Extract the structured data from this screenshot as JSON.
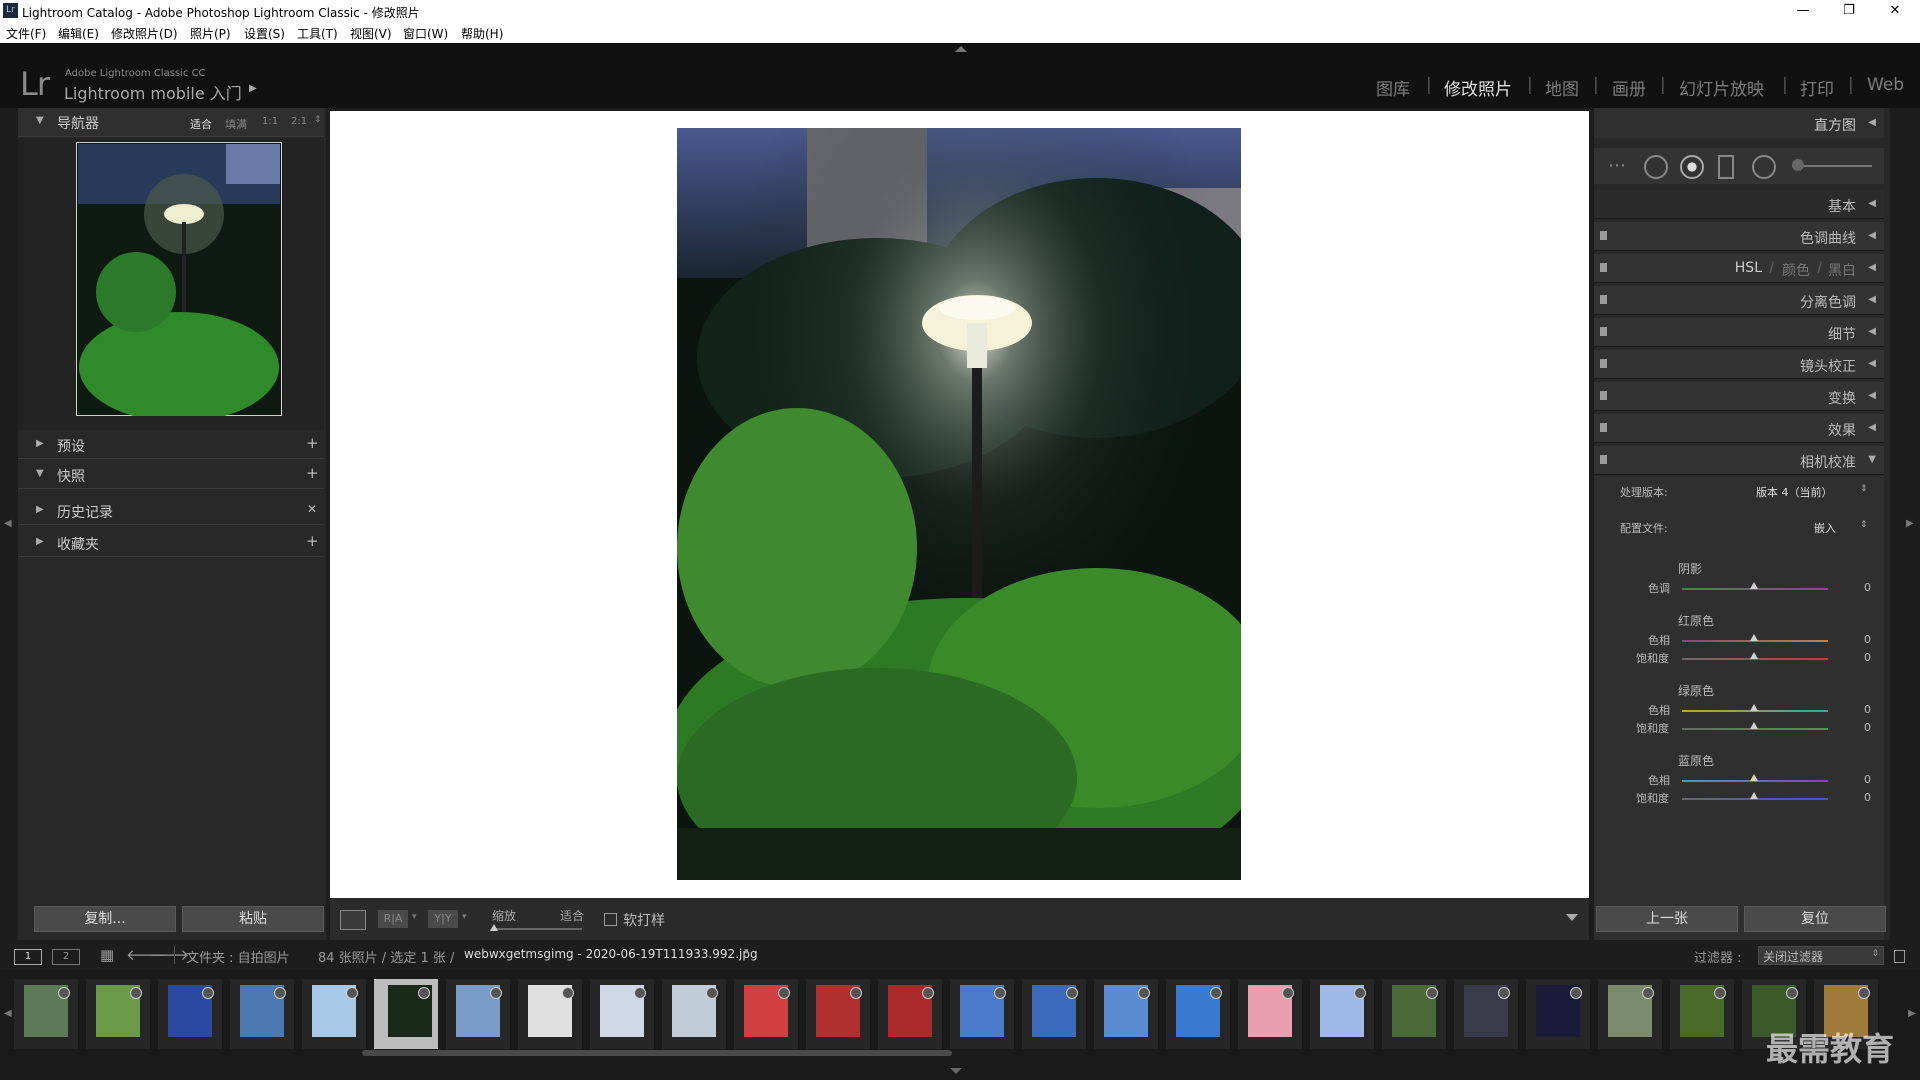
{
  "window": {
    "title": "Lightroom Catalog - Adobe Photoshop Lightroom Classic - 修改照片",
    "app_icon": "Lr",
    "controls": [
      "—",
      "❐",
      "✕"
    ]
  },
  "menu": [
    "文件(F)",
    "编辑(E)",
    "修改照片(D)",
    "照片(P)",
    "设置(S)",
    "工具(T)",
    "视图(V)",
    "窗口(W)",
    "帮助(H)"
  ],
  "header": {
    "logo": "Lr",
    "product_line1": "Adobe Lightroom Classic CC",
    "product_line2": "Lightroom mobile 入门",
    "modules": [
      "图库",
      "修改照片",
      "地图",
      "画册",
      "幻灯片放映",
      "打印",
      "Web"
    ],
    "active_module": "修改照片"
  },
  "left_panel": {
    "navigator": {
      "label": "导航器",
      "zoom_options": [
        "适合",
        "填满",
        "1:1",
        "2:1"
      ],
      "active_zoom": "适合"
    },
    "sections": [
      {
        "label": "预设",
        "action": "+"
      },
      {
        "label": "快照",
        "action": "+"
      },
      {
        "label": "历史记录",
        "action": "✕"
      },
      {
        "label": "收藏夹",
        "action": "+"
      }
    ],
    "copy_button": "复制...",
    "paste_button": "粘贴"
  },
  "toolbar": {
    "zoom_label": "缩放",
    "zoom_value": "适合",
    "soft_proof_label": "软打样",
    "view_buttons": [
      "R|A",
      "Y|Y"
    ]
  },
  "right_panel": {
    "histogram": "直方图",
    "sections": [
      {
        "label": "基本",
        "open": false
      },
      {
        "label": "色调曲线",
        "open": false
      },
      {
        "label": "HSL / 颜色 / 黑白",
        "open": false
      },
      {
        "label": "分离色调",
        "open": false
      },
      {
        "label": "细节",
        "open": false
      },
      {
        "label": "镜头校正",
        "open": false
      },
      {
        "label": "变换",
        "open": false
      },
      {
        "label": "效果",
        "open": false
      },
      {
        "label": "相机校准",
        "open": true
      }
    ],
    "hsl_parts": [
      "HSL",
      "颜色",
      "黑白"
    ],
    "calibration": {
      "process_label": "处理版本:",
      "process_value": "版本 4（当前）",
      "profile_label": "配置文件:",
      "profile_value": "嵌入",
      "groups": [
        {
          "title": "阴影",
          "rows": [
            {
              "label": "色调",
              "value": "0",
              "colors": [
                "#3a8a3a",
                "#a03aa0"
              ]
            }
          ]
        },
        {
          "title": "红原色",
          "rows": [
            {
              "label": "色相",
              "value": "0",
              "colors": [
                "#a03a7a",
                "#c8803a"
              ]
            },
            {
              "label": "饱和度",
              "value": "0",
              "colors": [
                "#6a6a6a",
                "#c83a3a"
              ]
            }
          ]
        },
        {
          "title": "绿原色",
          "rows": [
            {
              "label": "色相",
              "value": "0",
              "colors": [
                "#c8a03a",
                "#3aa0a0"
              ]
            },
            {
              "label": "饱和度",
              "value": "0",
              "colors": [
                "#6a6a6a",
                "#3aa03a"
              ]
            }
          ]
        },
        {
          "title": "蓝原色",
          "rows": [
            {
              "label": "色相",
              "value": "0",
              "colors": [
                "#3aa0c8",
                "#8a3ac8"
              ]
            },
            {
              "label": "饱和度",
              "value": "0",
              "colors": [
                "#6a6a6a",
                "#3a5ac8"
              ]
            }
          ]
        }
      ]
    },
    "prev_button": "上一张",
    "reset_button": "复位"
  },
  "filmstrip": {
    "page1": "1",
    "page2": "2",
    "source": "文件夹 : 自拍图片",
    "count": "84 张照片 / 选定 1 张 /",
    "filename": "webwxgetmsgimg - 2020-06-19T111933.992.jpg",
    "filter_label": "过滤器 :",
    "filter_value": "关闭过滤器",
    "thumb_colors": [
      "#5b7a55",
      "#6b9a48",
      "#2a4aa0",
      "#4a7ab0",
      "#a8c8e8",
      "#1a2a1a",
      "#7a9ac8",
      "#e0e0e0",
      "#d0d8e8",
      "#c0ccd8",
      "#d04040",
      "#b03030",
      "#a82a2a",
      "#4a7ac8",
      "#3a6ab8",
      "#5a8ad0",
      "#3a7ad0",
      "#e8a0b0",
      "#a0b8e8",
      "#4a6a3a",
      "#3a3a4a",
      "#1a1a3a",
      "#7a8a6a",
      "#4a6a2a",
      "#3a5a2a",
      "#a07a3a"
    ]
  },
  "watermark": "最需教育"
}
